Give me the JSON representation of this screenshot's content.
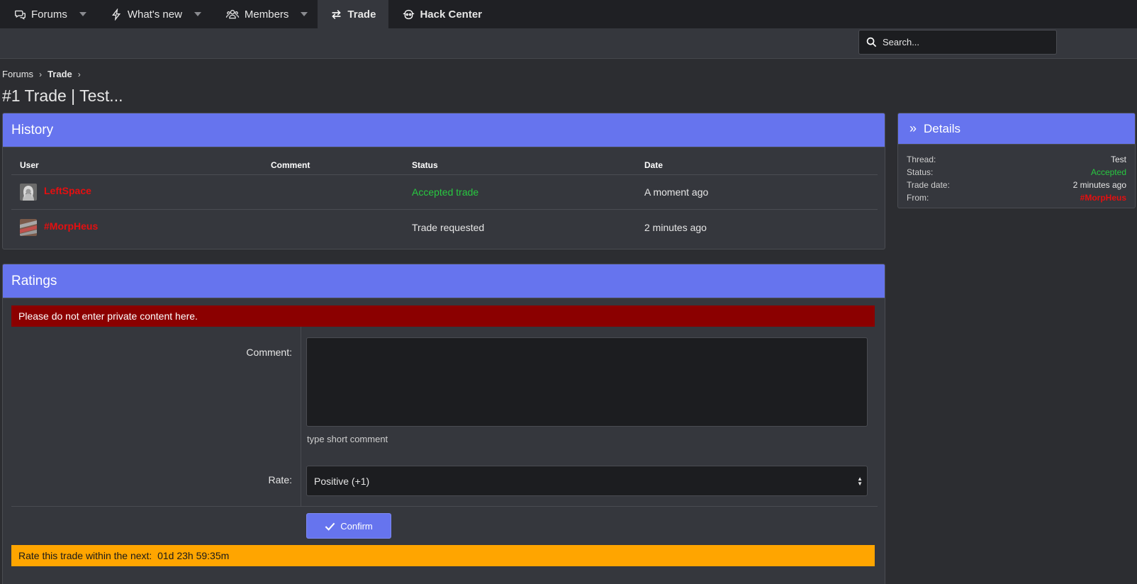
{
  "nav": {
    "items": [
      {
        "label": "Forums"
      },
      {
        "label": "What's new"
      },
      {
        "label": "Members"
      },
      {
        "label": "Trade"
      },
      {
        "label": "Hack Center"
      }
    ]
  },
  "search": {
    "placeholder": "Search..."
  },
  "breadcrumb": {
    "root": "Forums",
    "current": "Trade"
  },
  "page": {
    "title": "#1 Trade | Test..."
  },
  "history": {
    "title": "History",
    "columns": [
      "User",
      "Comment",
      "Status",
      "Date"
    ],
    "rows": [
      {
        "user": "LeftSpace",
        "comment": "",
        "status": "Accepted trade",
        "date": "A moment ago"
      },
      {
        "user": "#MorpHeus",
        "comment": "",
        "status": "Trade requested",
        "date": "2 minutes ago"
      }
    ]
  },
  "details": {
    "title": "Details",
    "rows": [
      {
        "label": "Thread:",
        "value": "Test"
      },
      {
        "label": "Status:",
        "value": "Accepted"
      },
      {
        "label": "Trade date:",
        "value": "2 minutes ago"
      },
      {
        "label": "From:",
        "value": "#MorpHeus"
      }
    ]
  },
  "ratings": {
    "title": "Ratings",
    "warning": "Please do not enter private content here.",
    "comment_label": "Comment:",
    "comment_value": "",
    "comment_hint": "type short comment",
    "rate_label": "Rate:",
    "rate_selected": "Positive (+1)",
    "confirm_label": "Confirm",
    "timer_text": "Rate this trade within the next:  01d 23h 59:35m"
  },
  "colors": {
    "accent": "#6674ee",
    "danger": "#8b0000",
    "warning": "#ffa500",
    "success": "#28c840",
    "username_red": "#e50f10"
  }
}
